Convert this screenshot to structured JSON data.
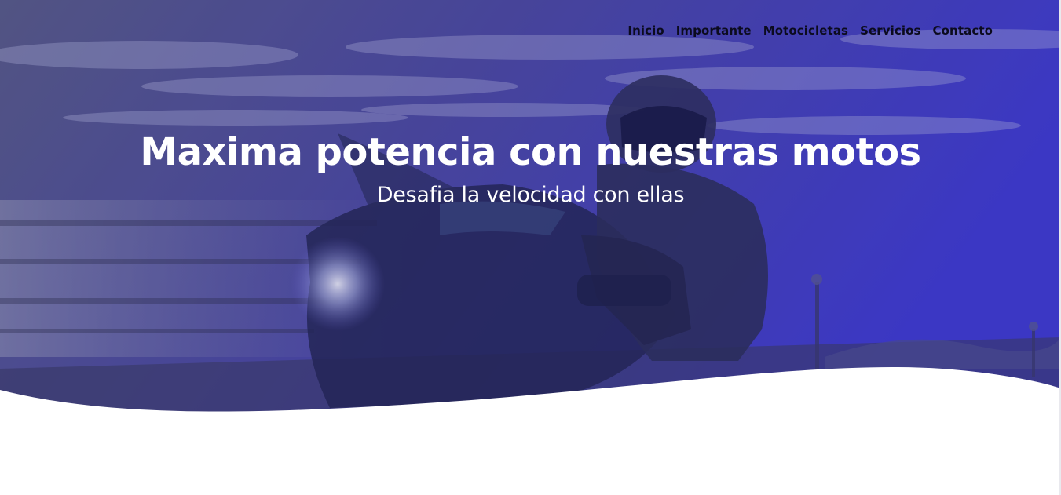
{
  "nav": {
    "items": [
      {
        "label": "Inicio"
      },
      {
        "label": "Importante"
      },
      {
        "label": "Motocicletas"
      },
      {
        "label": "Servicios"
      },
      {
        "label": "Contacto"
      }
    ]
  },
  "hero": {
    "title": "Maxima potencia con nuestras motos",
    "subtitle": "Desafia la velocidad con ellas"
  },
  "colors": {
    "overlay_start": "#4a4f7a",
    "overlay_end": "#3a36c4",
    "nav_text": "#0b0b1e",
    "hero_text": "#ffffff",
    "background": "#ffffff"
  }
}
